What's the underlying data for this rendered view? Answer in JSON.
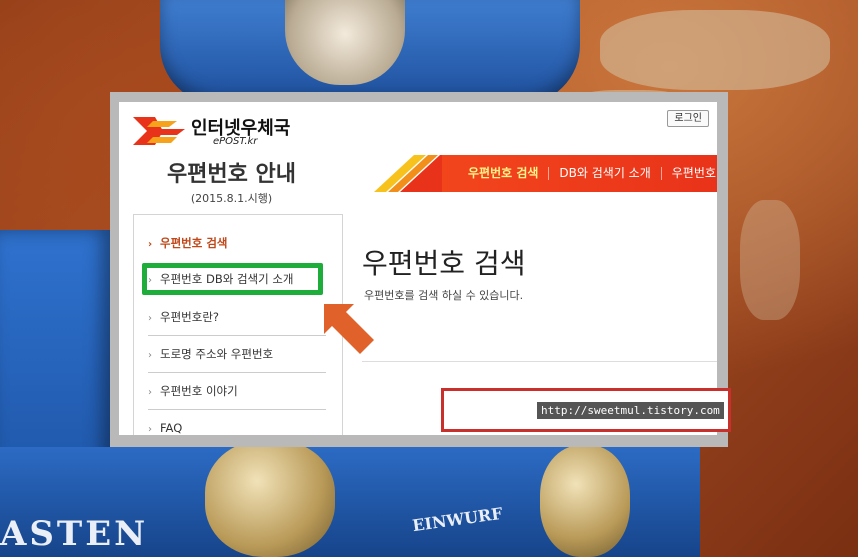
{
  "site": {
    "name": "인터넷우체국",
    "sub": "ePOST.kr",
    "login_label": "로그인"
  },
  "heading": {
    "title": "우편번호 안내",
    "subtitle": "(2015.8.1.시행)"
  },
  "top_nav": [
    {
      "label": "우편번호 검색",
      "active": true
    },
    {
      "label": "DB와 검색기 소개",
      "active": false
    },
    {
      "label": "우편번호",
      "active": false
    }
  ],
  "sidebar": {
    "items": [
      {
        "label": "우편번호 검색",
        "active": true
      },
      {
        "label": "우편번호 DB와 검색기 소개",
        "active": false,
        "highlighted": true
      },
      {
        "label": "우편번호란?",
        "active": false
      },
      {
        "label": "도로명 주소와 우편번호",
        "active": false
      },
      {
        "label": "우편번호 이야기",
        "active": false
      },
      {
        "label": "FAQ",
        "active": false
      }
    ]
  },
  "main": {
    "title": "우편번호 검색",
    "description": "우편번호를 검색 하실 수 있습니다."
  },
  "photo": {
    "kasten_text": "ASTEN",
    "einwurf_text": "EINWURF"
  },
  "watermark": "http://sweetmul.tistory.com",
  "colors": {
    "nav_red": "#e8321a",
    "highlight_green": "#1eac3a",
    "arrow_orange": "#e0622a",
    "search_border": "#c9302c",
    "active_link": "#c0481a"
  }
}
